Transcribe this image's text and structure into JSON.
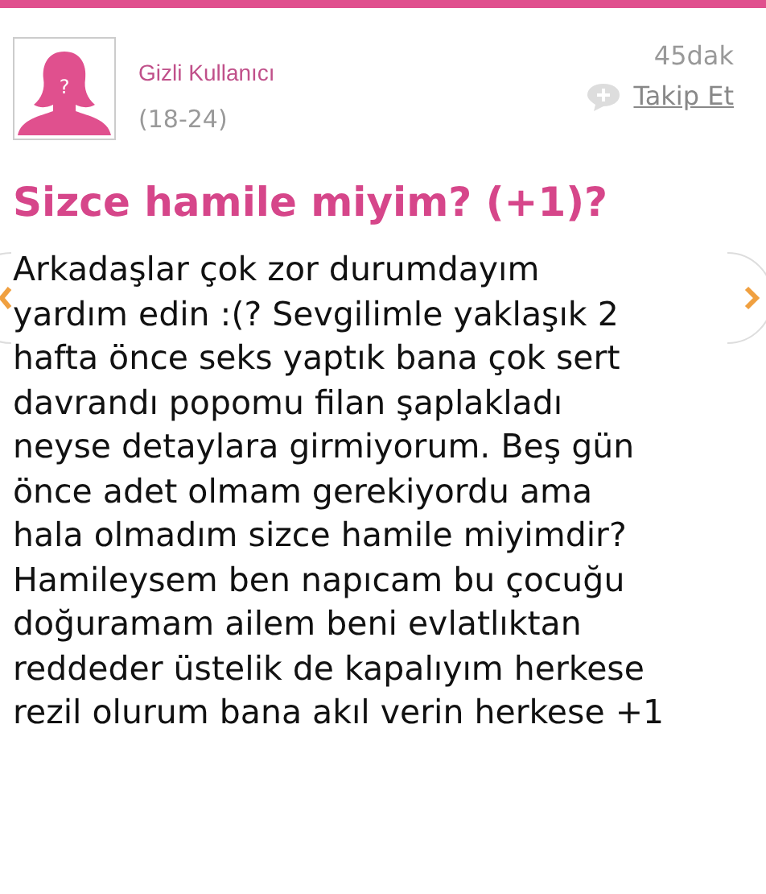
{
  "author": {
    "avatar_mark": "?",
    "name": "Gizli Kullanıcı",
    "age": "(18-24)",
    "time": "45dak",
    "follow": "Takip Et"
  },
  "question": {
    "title": "Sizce hamile miyim? (+1)?",
    "lines": [
      "Arkadaşlar çok zor durumdayım",
      "yardım edin :(? Sevgilimle yaklaşık 2",
      "hafta önce seks yaptık bana çok sert",
      "davrandı popomu filan şaplakladı",
      "neyse detaylara girmiyorum. Beş gün",
      "önce adet olmam gerekiyordu ama",
      "hala olmadım sizce hamile miyimdir?",
      "Hamileysem ben napıcam bu çocuğu",
      "doğuramam ailem beni evlatlıktan",
      "reddeder üstelik de kapalıyım herkese",
      "rezil olurum bana akıl verin herkese +1"
    ]
  }
}
